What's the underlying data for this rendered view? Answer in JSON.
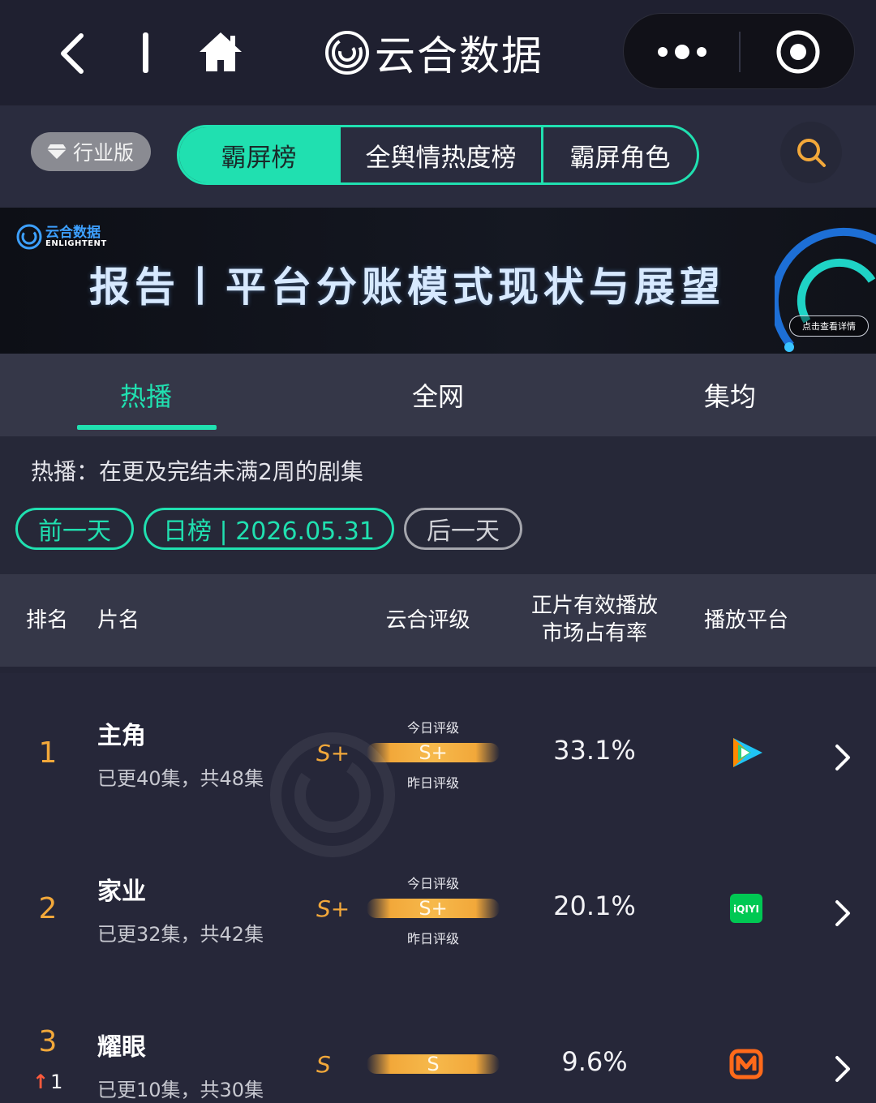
{
  "app": {
    "title": "云合数据",
    "icons": {
      "back": "chevron-left-icon",
      "home": "home-icon",
      "more": "more-dots-icon",
      "close": "target-icon",
      "logo": "yunhe-logo-icon"
    }
  },
  "header": {
    "industry_badge": "行业版",
    "segments": [
      {
        "label": "霸屏榜",
        "active": true
      },
      {
        "label": "全舆情热度榜",
        "active": false
      },
      {
        "label": "霸屏角色",
        "active": false
      }
    ],
    "search_icon": "search-icon",
    "accent_color": "#20e0b0"
  },
  "banner": {
    "logo_cn": "云合数据",
    "logo_en": "ENLIGHTENT",
    "title": "报告丨平台分账模式现状与展望",
    "button": "点击查看详情"
  },
  "subtabs": [
    {
      "label": "热播",
      "active": true
    },
    {
      "label": "全网",
      "active": false
    },
    {
      "label": "集均",
      "active": false
    }
  ],
  "filter": {
    "description": "热播：在更及完结未满2周的剧集",
    "prev": "前一天",
    "date": "日榜 | 2026.05.31",
    "next": "后一天"
  },
  "table": {
    "headers": {
      "rank": "排名",
      "title": "片名",
      "grade": "云合评级",
      "share_line1": "正片有效播放",
      "share_line2": "市场占有率",
      "platform": "播放平台"
    },
    "today_label": "今日评级",
    "yesterday_label": "昨日评级",
    "rows": [
      {
        "rank": "1",
        "title": "主角",
        "episodes": "已更40集，共48集",
        "grade": "S+",
        "bar_grade": "S+",
        "share": "33.1%",
        "platform": "tencent-video-icon",
        "rank_change": ""
      },
      {
        "rank": "2",
        "title": "家业",
        "episodes": "已更32集，共42集",
        "grade": "S+",
        "bar_grade": "S+",
        "share": "20.1%",
        "platform": "iqiyi-icon",
        "rank_change": ""
      },
      {
        "rank": "3",
        "title": "耀眼",
        "episodes": "已更10集，共30集",
        "grade": "S",
        "bar_grade": "S",
        "share": "9.6%",
        "platform": "mango-tv-icon",
        "rank_change": "1"
      }
    ]
  },
  "colors": {
    "accent": "#20e0b0",
    "rank_gold": "#f2a83a",
    "rank_up": "#ff5a3c",
    "iqiyi_green": "#00c853",
    "mango_orange": "#ff6a1a"
  }
}
